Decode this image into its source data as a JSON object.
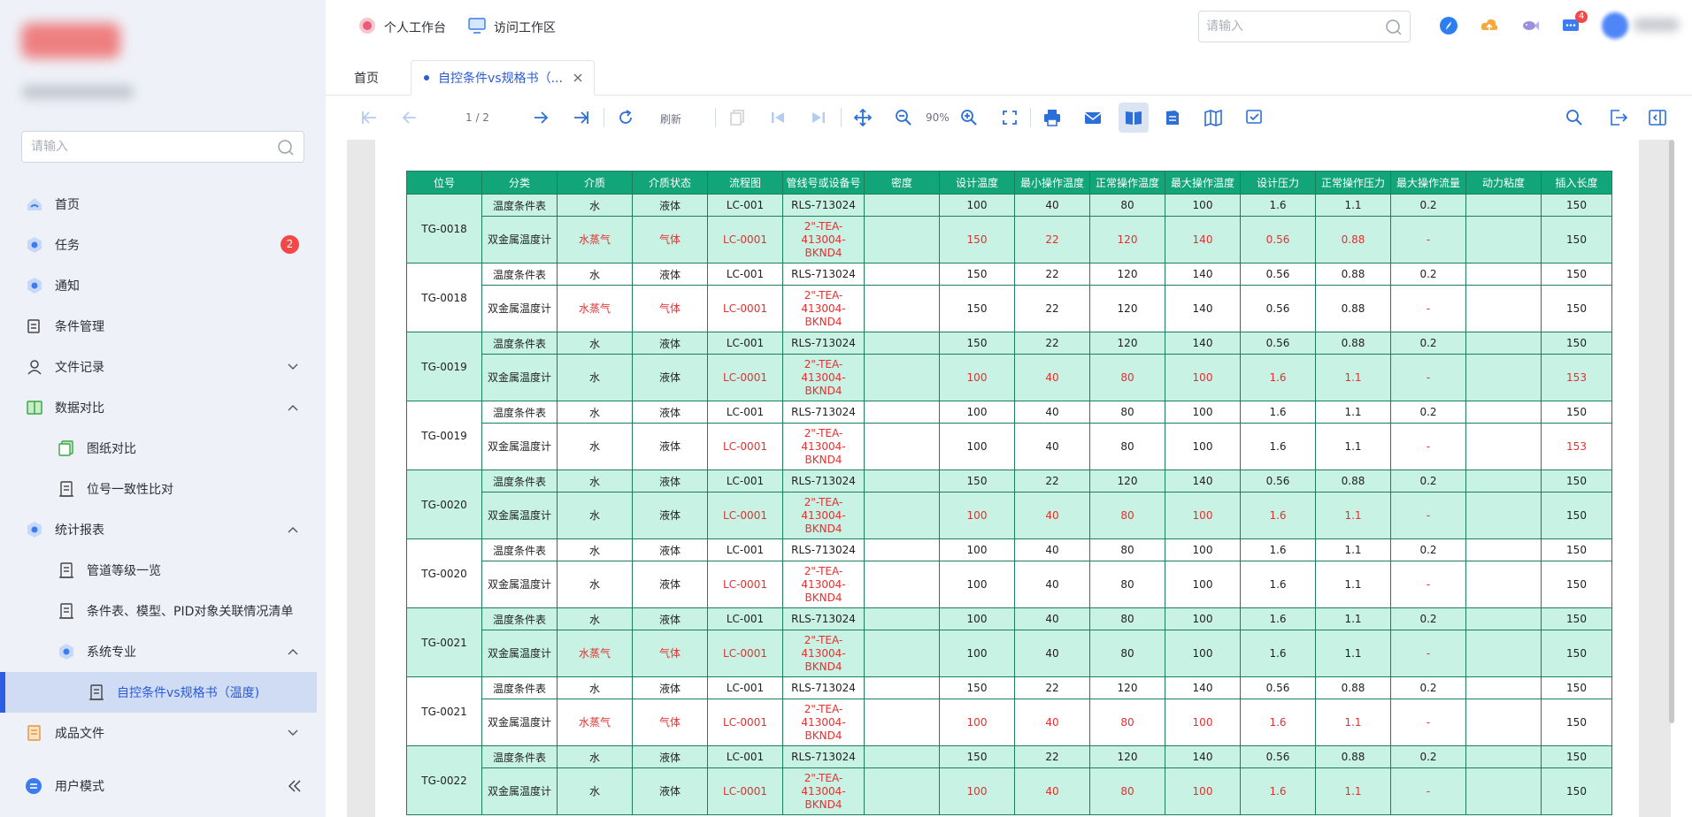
{
  "sidebar": {
    "search_placeholder": "请输入",
    "items": [
      {
        "label": "首页",
        "icon": "home-icon"
      },
      {
        "label": "任务",
        "icon": "task-icon",
        "badge": "2"
      },
      {
        "label": "通知",
        "icon": "notice-icon"
      },
      {
        "label": "条件管理",
        "icon": "conditions-icon"
      },
      {
        "label": "文件记录",
        "icon": "user-icon"
      },
      {
        "label": "数据对比",
        "icon": "book-icon"
      },
      {
        "label": "图纸对比",
        "icon": "drawing-icon"
      },
      {
        "label": "位号一致性比对",
        "icon": "doc-icon"
      },
      {
        "label": "统计报表",
        "icon": "report-icon"
      },
      {
        "label": "管道等级一览",
        "icon": "doc-icon"
      },
      {
        "label": "条件表、模型、PID对象关联情况清单",
        "icon": "doc-icon"
      },
      {
        "label": "系统专业",
        "icon": "system-icon"
      },
      {
        "label": "自控条件vs规格书（温度)",
        "icon": "doc-icon"
      },
      {
        "label": "成品文件",
        "icon": "files-icon"
      }
    ],
    "bottom_label": "用户模式"
  },
  "topbar": {
    "nav1": "个人工作台",
    "nav2": "访问工作区",
    "search_placeholder": "请输入",
    "msg_count": "4"
  },
  "tabs": {
    "home": "首页",
    "current": "自控条件vs规格书（..."
  },
  "viewer": {
    "page": "1 / 2",
    "refresh": "刷新",
    "zoom": "90%"
  },
  "table": {
    "headers": [
      "位号",
      "分类",
      "介质",
      "介质状态",
      "流程图",
      "管线号或设备号",
      "密度",
      "设计温度",
      "最小操作温度",
      "正常操作温度",
      "最大操作温度",
      "设计压力",
      "正常操作压力",
      "最大操作流量",
      "动力粘度",
      "插入长度"
    ],
    "groups": [
      {
        "tag": "TG-0018",
        "row1": [
          "温度条件表",
          "水",
          "液体",
          "LC-001",
          "RLS-713024",
          "",
          "100",
          "40",
          "80",
          "100",
          "1.6",
          "1.1",
          "0.2",
          "",
          "150"
        ],
        "row2": [
          "双金属温度计",
          "水蒸气",
          "气体",
          "LC-0001",
          "2\"-TEA-413004-BKND4",
          "",
          "150",
          "22",
          "120",
          "140",
          "0.56",
          "0.88",
          "-",
          "",
          "150"
        ]
      },
      {
        "tag": "TG-0018",
        "row1": [
          "温度条件表",
          "水",
          "液体",
          "LC-001",
          "RLS-713024",
          "",
          "150",
          "22",
          "120",
          "140",
          "0.56",
          "0.88",
          "0.2",
          "",
          "150"
        ],
        "row2": [
          "双金属温度计",
          "水蒸气",
          "气体",
          "LC-0001",
          "2\"-TEA-413004-BKND4",
          "",
          "150",
          "22",
          "120",
          "140",
          "0.56",
          "0.88",
          "-",
          "",
          "150"
        ]
      },
      {
        "tag": "TG-0019",
        "row1": [
          "温度条件表",
          "水",
          "液体",
          "LC-001",
          "RLS-713024",
          "",
          "150",
          "22",
          "120",
          "140",
          "0.56",
          "0.88",
          "0.2",
          "",
          "150"
        ],
        "row2": [
          "双金属温度计",
          "水",
          "液体",
          "LC-0001",
          "2\"-TEA-413004-BKND4",
          "",
          "100",
          "40",
          "80",
          "100",
          "1.6",
          "1.1",
          "-",
          "",
          "153"
        ]
      },
      {
        "tag": "TG-0019",
        "row1": [
          "温度条件表",
          "水",
          "液体",
          "LC-001",
          "RLS-713024",
          "",
          "100",
          "40",
          "80",
          "100",
          "1.6",
          "1.1",
          "0.2",
          "",
          "150"
        ],
        "row2": [
          "双金属温度计",
          "水",
          "液体",
          "LC-0001",
          "2\"-TEA-413004-BKND4",
          "",
          "100",
          "40",
          "80",
          "100",
          "1.6",
          "1.1",
          "-",
          "",
          "153"
        ]
      },
      {
        "tag": "TG-0020",
        "row1": [
          "温度条件表",
          "水",
          "液体",
          "LC-001",
          "RLS-713024",
          "",
          "150",
          "22",
          "120",
          "140",
          "0.56",
          "0.88",
          "0.2",
          "",
          "150"
        ],
        "row2": [
          "双金属温度计",
          "水",
          "液体",
          "LC-0001",
          "2\"-TEA-413004-BKND4",
          "",
          "100",
          "40",
          "80",
          "100",
          "1.6",
          "1.1",
          "-",
          "",
          "150"
        ]
      },
      {
        "tag": "TG-0020",
        "row1": [
          "温度条件表",
          "水",
          "液体",
          "LC-001",
          "RLS-713024",
          "",
          "100",
          "40",
          "80",
          "100",
          "1.6",
          "1.1",
          "0.2",
          "",
          "150"
        ],
        "row2": [
          "双金属温度计",
          "水",
          "液体",
          "LC-0001",
          "2\"-TEA-413004-BKND4",
          "",
          "100",
          "40",
          "80",
          "100",
          "1.6",
          "1.1",
          "-",
          "",
          "150"
        ]
      },
      {
        "tag": "TG-0021",
        "row1": [
          "温度条件表",
          "水",
          "液体",
          "LC-001",
          "RLS-713024",
          "",
          "100",
          "40",
          "80",
          "100",
          "1.6",
          "1.1",
          "0.2",
          "",
          "150"
        ],
        "row2": [
          "双金属温度计",
          "水蒸气",
          "气体",
          "LC-0001",
          "2\"-TEA-413004-BKND4",
          "",
          "100",
          "40",
          "80",
          "100",
          "1.6",
          "1.1",
          "-",
          "",
          "150"
        ]
      },
      {
        "tag": "TG-0021",
        "row1": [
          "温度条件表",
          "水",
          "液体",
          "LC-001",
          "RLS-713024",
          "",
          "150",
          "22",
          "120",
          "140",
          "0.56",
          "0.88",
          "0.2",
          "",
          "150"
        ],
        "row2": [
          "双金属温度计",
          "水蒸气",
          "气体",
          "LC-0001",
          "2\"-TEA-413004-BKND4",
          "",
          "100",
          "40",
          "80",
          "100",
          "1.6",
          "1.1",
          "-",
          "",
          "150"
        ]
      },
      {
        "tag": "TG-0022",
        "row1": [
          "温度条件表",
          "水",
          "液体",
          "LC-001",
          "RLS-713024",
          "",
          "150",
          "22",
          "120",
          "140",
          "0.56",
          "0.88",
          "0.2",
          "",
          "150"
        ],
        "row2": [
          "双金属温度计",
          "水",
          "液体",
          "LC-0001",
          "2\"-TEA-413004-BKND4",
          "",
          "100",
          "40",
          "80",
          "100",
          "1.6",
          "1.1",
          "-",
          "",
          "150"
        ]
      }
    ]
  },
  "colors": {
    "accent": "#2a5bd7",
    "table_header": "#11a579",
    "table_alt_row": "#c8f2e4",
    "diff_text": "#e53030",
    "badge": "#f24848"
  }
}
